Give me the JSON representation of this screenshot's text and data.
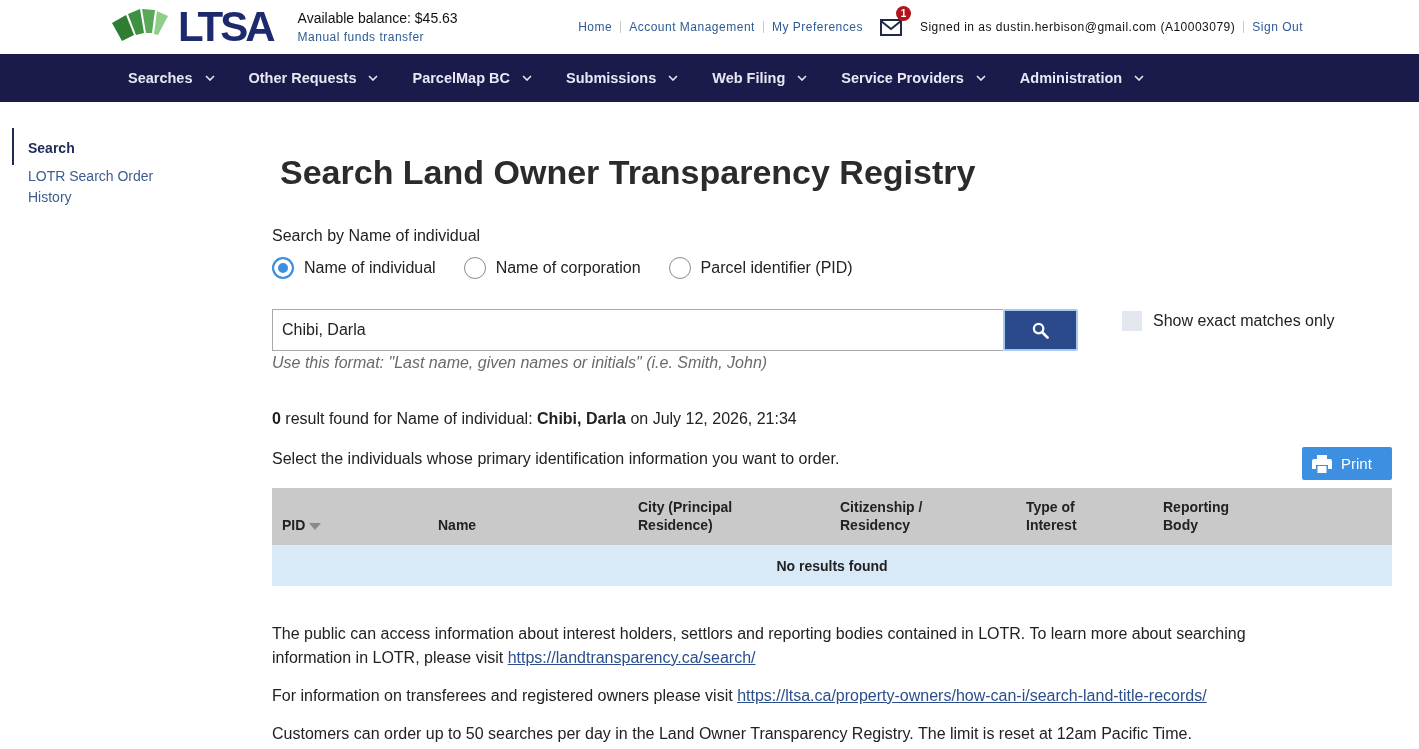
{
  "header": {
    "logo_text": "LTSA",
    "balance": "Available balance: $45.63",
    "funds_link": "Manual funds transfer",
    "links": [
      "Home",
      "Account Management",
      "My Preferences"
    ],
    "messages_badge": "1",
    "signed_in": "Signed in as dustin.herbison@gmail.com (A10003079)",
    "sign_out": "Sign Out"
  },
  "nav": {
    "items": [
      "Searches",
      "Other Requests",
      "ParcelMap BC",
      "Submissions",
      "Web Filing",
      "Service Providers",
      "Administration"
    ]
  },
  "sidebar": {
    "items": [
      {
        "label": "Search",
        "selected": true
      },
      {
        "label": "LOTR Search Order History",
        "selected": false
      }
    ]
  },
  "main": {
    "title": "Search Land Owner Transparency Registry",
    "search_by_label": "Search by Name of individual",
    "search_types": [
      {
        "label": "Name of individual",
        "selected": true
      },
      {
        "label": "Name of corporation",
        "selected": false
      },
      {
        "label": "Parcel identifier (PID)",
        "selected": false
      }
    ],
    "search_field": {
      "value": "Chibi, Darla"
    },
    "search_hint": "Use this format: \"Last name, given names or initials\" (i.e. Smith, John)",
    "exact_matches": {
      "label": "Show exact matches only",
      "checked": false
    },
    "result_summary": "**0** result found for Name of individual: **Chibi, Darla** on July 12, 2026, 21:34",
    "instruction": "Select the individuals whose primary identification information you want to order.",
    "print_button": "Print",
    "table": {
      "columns": [
        {
          "label": "PID",
          "sorted": true
        },
        {
          "label": "Name",
          "sorted": false
        },
        {
          "label": "City (Principal Residence)",
          "sorted": false
        },
        {
          "label": "Citizenship / Residency",
          "sorted": false
        },
        {
          "label": "Type of Interest",
          "sorted": false
        },
        {
          "label": "Reporting Body",
          "sorted": false
        }
      ],
      "empty_message": "No results found"
    },
    "info": [
      {
        "text": "The public can access information about interest holders, settlors and reporting bodies contained in LOTR. To learn more about searching information in LOTR, please visit ",
        "link": "https://landtransparency.ca/search/"
      },
      {
        "text": "For information on transferees and registered owners please visit ",
        "link": "https://ltsa.ca/property-owners/how-can-i/search-land-title-records/"
      },
      {
        "text": "Customers can order up to 50 searches per day in the Land Owner Transparency Registry. The limit is reset at 12am Pacific Time."
      }
    ]
  }
}
